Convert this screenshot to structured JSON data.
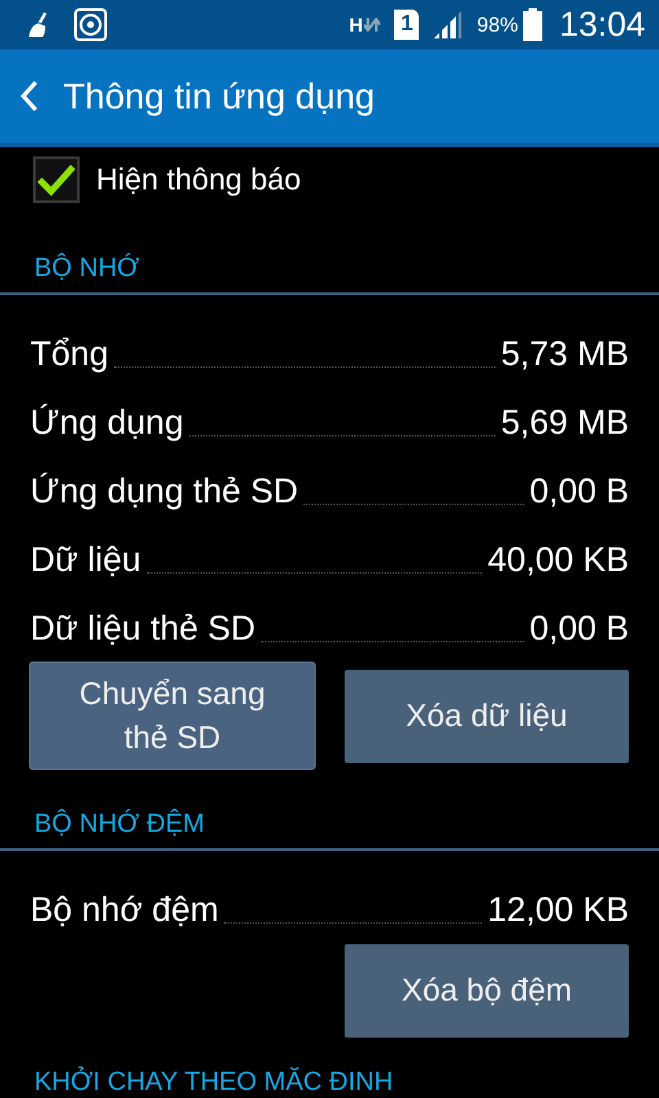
{
  "status_bar": {
    "network_type": "H",
    "sim_slot": "1",
    "battery": "98%",
    "time": "13:04"
  },
  "app_bar": {
    "title": "Thông tin ứng dụng"
  },
  "notification": {
    "label": "Hiện thông báo",
    "checked": true
  },
  "sections": [
    {
      "title": "BỘ NHỚ",
      "rows": [
        {
          "label": "Tổng",
          "value": "5,73 MB"
        },
        {
          "label": "Ứng dụng",
          "value": "5,69 MB"
        },
        {
          "label": "Ứng dụng thẻ SD",
          "value": "0,00 B"
        },
        {
          "label": "Dữ liệu",
          "value": "40,00 KB"
        },
        {
          "label": "Dữ liệu thẻ SD",
          "value": "0,00 B"
        }
      ],
      "buttons": [
        {
          "label": "Chuyển sang thẻ SD",
          "pressed": true
        },
        {
          "label": "Xóa dữ liệu",
          "pressed": false
        }
      ]
    },
    {
      "title": "BỘ NHỚ ĐỆM",
      "rows": [
        {
          "label": "Bộ nhớ đệm",
          "value": "12,00 KB"
        }
      ],
      "buttons": [
        {
          "label": "Xóa bộ đệm",
          "pressed": false
        }
      ]
    },
    {
      "title": "KHỞI CHAY THEO MĂC ĐINH"
    }
  ]
}
